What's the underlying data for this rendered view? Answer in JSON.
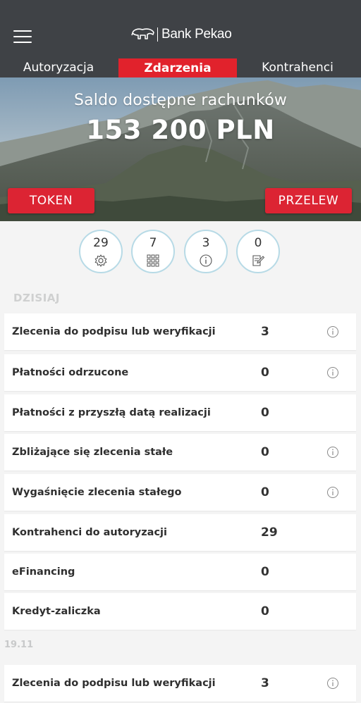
{
  "header": {
    "menu_icon": "hamburger-menu-icon",
    "logo_text": "Bank Pekao",
    "logo_icon": "bison-logo-icon"
  },
  "tabs": [
    {
      "label": "Autoryzacja",
      "active": false
    },
    {
      "label": "Zdarzenia",
      "active": true
    },
    {
      "label": "Kontrahenci",
      "active": false
    }
  ],
  "hero": {
    "caption": "Saldo dostępne rachunków",
    "amount": "153 200 PLN"
  },
  "actions": {
    "token_label": "TOKEN",
    "przelew_label": "PRZELEW"
  },
  "summary": [
    {
      "count": "29",
      "icon": "gear-icon"
    },
    {
      "count": "7",
      "icon": "grid-icon"
    },
    {
      "count": "3",
      "icon": "info-icon"
    },
    {
      "count": "0",
      "icon": "document-edit-icon"
    }
  ],
  "sections": {
    "today_label": "DZISIAJ",
    "date_label": "19.11"
  },
  "rows": [
    {
      "label": "Zlecenia do podpisu lub weryfikacji",
      "value": "3",
      "info": true
    },
    {
      "label": "Płatności odrzucone",
      "value": "0",
      "info": true
    },
    {
      "label": "Płatności z przyszłą datą realizacji",
      "value": "0",
      "info": false
    },
    {
      "label": "Zbliżające się zlecenia stałe",
      "value": "0",
      "info": true
    },
    {
      "label": "Wygaśnięcie zlecenia stałego",
      "value": "0",
      "info": true
    },
    {
      "label": "Kontrahenci do autoryzacji",
      "value": "29",
      "info": false
    },
    {
      "label": "eFinancing",
      "value": "0",
      "info": false
    },
    {
      "label": "Kredyt-zaliczka",
      "value": "0",
      "info": false
    },
    {
      "label": "Zlecenia do podpisu lub weryfikacji",
      "value": "3",
      "info": true
    }
  ],
  "colors": {
    "header_bg": "#3f4246",
    "accent_red": "#e1222c",
    "circle_border": "#b7dae6"
  }
}
